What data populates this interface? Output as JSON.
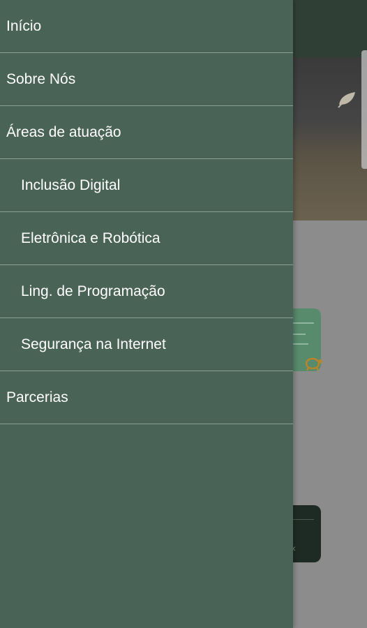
{
  "drawer": {
    "items": [
      {
        "label": "Início",
        "level": 0
      },
      {
        "label": "Sobre Nós",
        "level": 0
      },
      {
        "label": "Áreas de atuação",
        "level": 0
      },
      {
        "label": "Inclusão Digital",
        "level": 1
      },
      {
        "label": "Eletrônica e Robótica",
        "level": 1
      },
      {
        "label": "Ling. de Programação",
        "level": 1
      },
      {
        "label": "Segurança na Internet",
        "level": 1
      },
      {
        "label": "Parcerias",
        "level": 0
      }
    ]
  },
  "colors": {
    "drawer_bg": "#496357",
    "divider": "#8aa095",
    "text": "#ffffff",
    "scrim": "#8a8a8a",
    "card_green": "#4f8a66"
  },
  "icons": {
    "hero": "leaf-icon",
    "card_badge": "turtle-icon",
    "toast_close": "close-icon"
  },
  "background": {
    "toast_close_glyph": "×"
  }
}
